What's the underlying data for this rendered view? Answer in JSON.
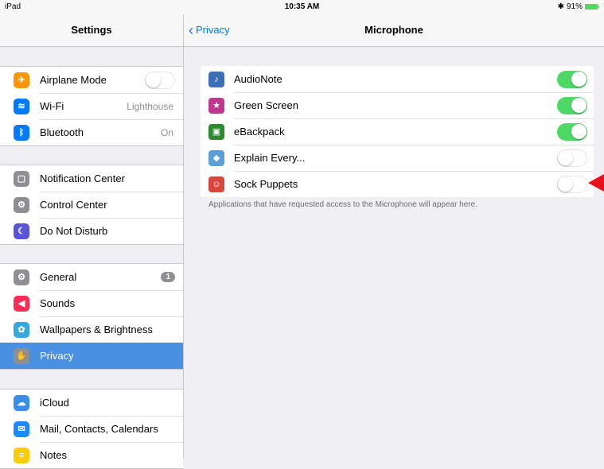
{
  "status_bar": {
    "device": "iPad",
    "time": "10:35 AM",
    "battery": "91%"
  },
  "sidebar": {
    "title": "Settings",
    "groups": [
      [
        {
          "label": "Airplane Mode",
          "icon": "airplane-icon",
          "color": "#ff9500",
          "toggle": "off"
        },
        {
          "label": "Wi-Fi",
          "icon": "wifi-icon",
          "color": "#007aff",
          "value": "Lighthouse"
        },
        {
          "label": "Bluetooth",
          "icon": "bluetooth-icon",
          "color": "#007aff",
          "value": "On"
        }
      ],
      [
        {
          "label": "Notification Center",
          "icon": "notification-icon",
          "color": "#8e8e93"
        },
        {
          "label": "Control Center",
          "icon": "control-center-icon",
          "color": "#8e8e93"
        },
        {
          "label": "Do Not Disturb",
          "icon": "moon-icon",
          "color": "#5856d6"
        }
      ],
      [
        {
          "label": "General",
          "icon": "gear-icon",
          "color": "#8e8e93",
          "badge": "1"
        },
        {
          "label": "Sounds",
          "icon": "speaker-icon",
          "color": "#ff2d55"
        },
        {
          "label": "Wallpapers & Brightness",
          "icon": "flower-icon",
          "color": "#34aadc"
        },
        {
          "label": "Privacy",
          "icon": "hand-icon",
          "color": "#8e8e93",
          "selected": true
        }
      ],
      [
        {
          "label": "iCloud",
          "icon": "cloud-icon",
          "color": "#3a8ee6"
        },
        {
          "label": "Mail, Contacts, Calendars",
          "icon": "mail-icon",
          "color": "#1a8cff"
        },
        {
          "label": "Notes",
          "icon": "notes-icon",
          "color": "#ffcc00"
        }
      ]
    ]
  },
  "main": {
    "back_label": "Privacy",
    "title": "Microphone",
    "apps": [
      {
        "label": "AudioNote",
        "icon": "audionote-icon",
        "color": "#3b6fb6",
        "on": true
      },
      {
        "label": "Green Screen",
        "icon": "greenscreen-icon",
        "color": "#c0378e",
        "on": true
      },
      {
        "label": "eBackpack",
        "icon": "ebackpack-icon",
        "color": "#2f8a2f",
        "on": true
      },
      {
        "label": "Explain Every...",
        "icon": "explaineverything-icon",
        "color": "#5aa0d8",
        "on": false
      },
      {
        "label": "Sock Puppets",
        "icon": "sockpuppets-icon",
        "color": "#d9463e",
        "on": false
      }
    ],
    "footnote": "Applications that have requested access to the Microphone will appear here."
  }
}
